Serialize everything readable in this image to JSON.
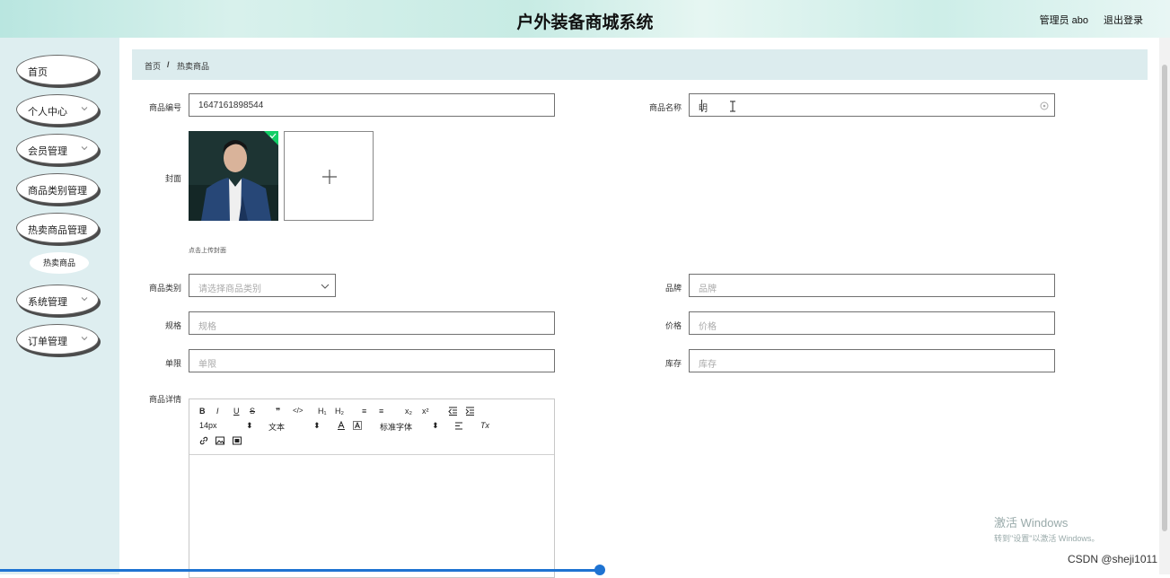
{
  "header": {
    "title": "户外装备商城系统",
    "admin": "管理员 abo",
    "logout": "退出登录"
  },
  "sidebar": {
    "items": [
      {
        "label": "首页",
        "has_chevron": false
      },
      {
        "label": "个人中心",
        "has_chevron": true
      },
      {
        "label": "会员管理",
        "has_chevron": true
      },
      {
        "label": "商品类别管理",
        "has_chevron": false
      },
      {
        "label": "热卖商品管理",
        "has_chevron": false
      },
      {
        "label": "系统管理",
        "has_chevron": true
      },
      {
        "label": "订单管理",
        "has_chevron": true
      }
    ],
    "subitem": "热卖商品"
  },
  "breadcrumb": {
    "home": "首页",
    "sep": "/",
    "current": "热卖商品"
  },
  "form": {
    "product_code_label": "商品编号",
    "product_code_value": "1647161898544",
    "product_name_label": "商品名称",
    "product_name_value": "明",
    "cover_label": "封面",
    "cover_hint": "点击上传封面",
    "category_label": "商品类别",
    "category_placeholder": "请选择商品类别",
    "brand_label": "品牌",
    "brand_placeholder": "品牌",
    "spec_label": "规格",
    "spec_placeholder": "规格",
    "price_label": "价格",
    "price_placeholder": "价格",
    "limit_label": "单限",
    "limit_placeholder": "单限",
    "stock_label": "库存",
    "stock_placeholder": "库存",
    "detail_label": "商品详情"
  },
  "editor": {
    "bold": "B",
    "italic": "I",
    "underline": "U",
    "strike": "S",
    "quote": "❞",
    "code": "</>",
    "h1": "H₁",
    "h2": "H₂",
    "ol": "≡",
    "ul": "≡",
    "sub": "x₂",
    "sup": "x²",
    "font_size": "14px",
    "text_style": "文本",
    "font_family": "标准字体",
    "clear": "Tx"
  },
  "overlay": {
    "watermark_line1": "激活 Windows",
    "watermark_line2": "转到\"设置\"以激活 Windows。",
    "csdn": "CSDN @sheji1011"
  },
  "colors": {
    "sidebar_bg": "#deeef0",
    "breadcrumb_bg": "#dcecee",
    "accent": "#1e73d2",
    "check_green": "#13ce66"
  }
}
